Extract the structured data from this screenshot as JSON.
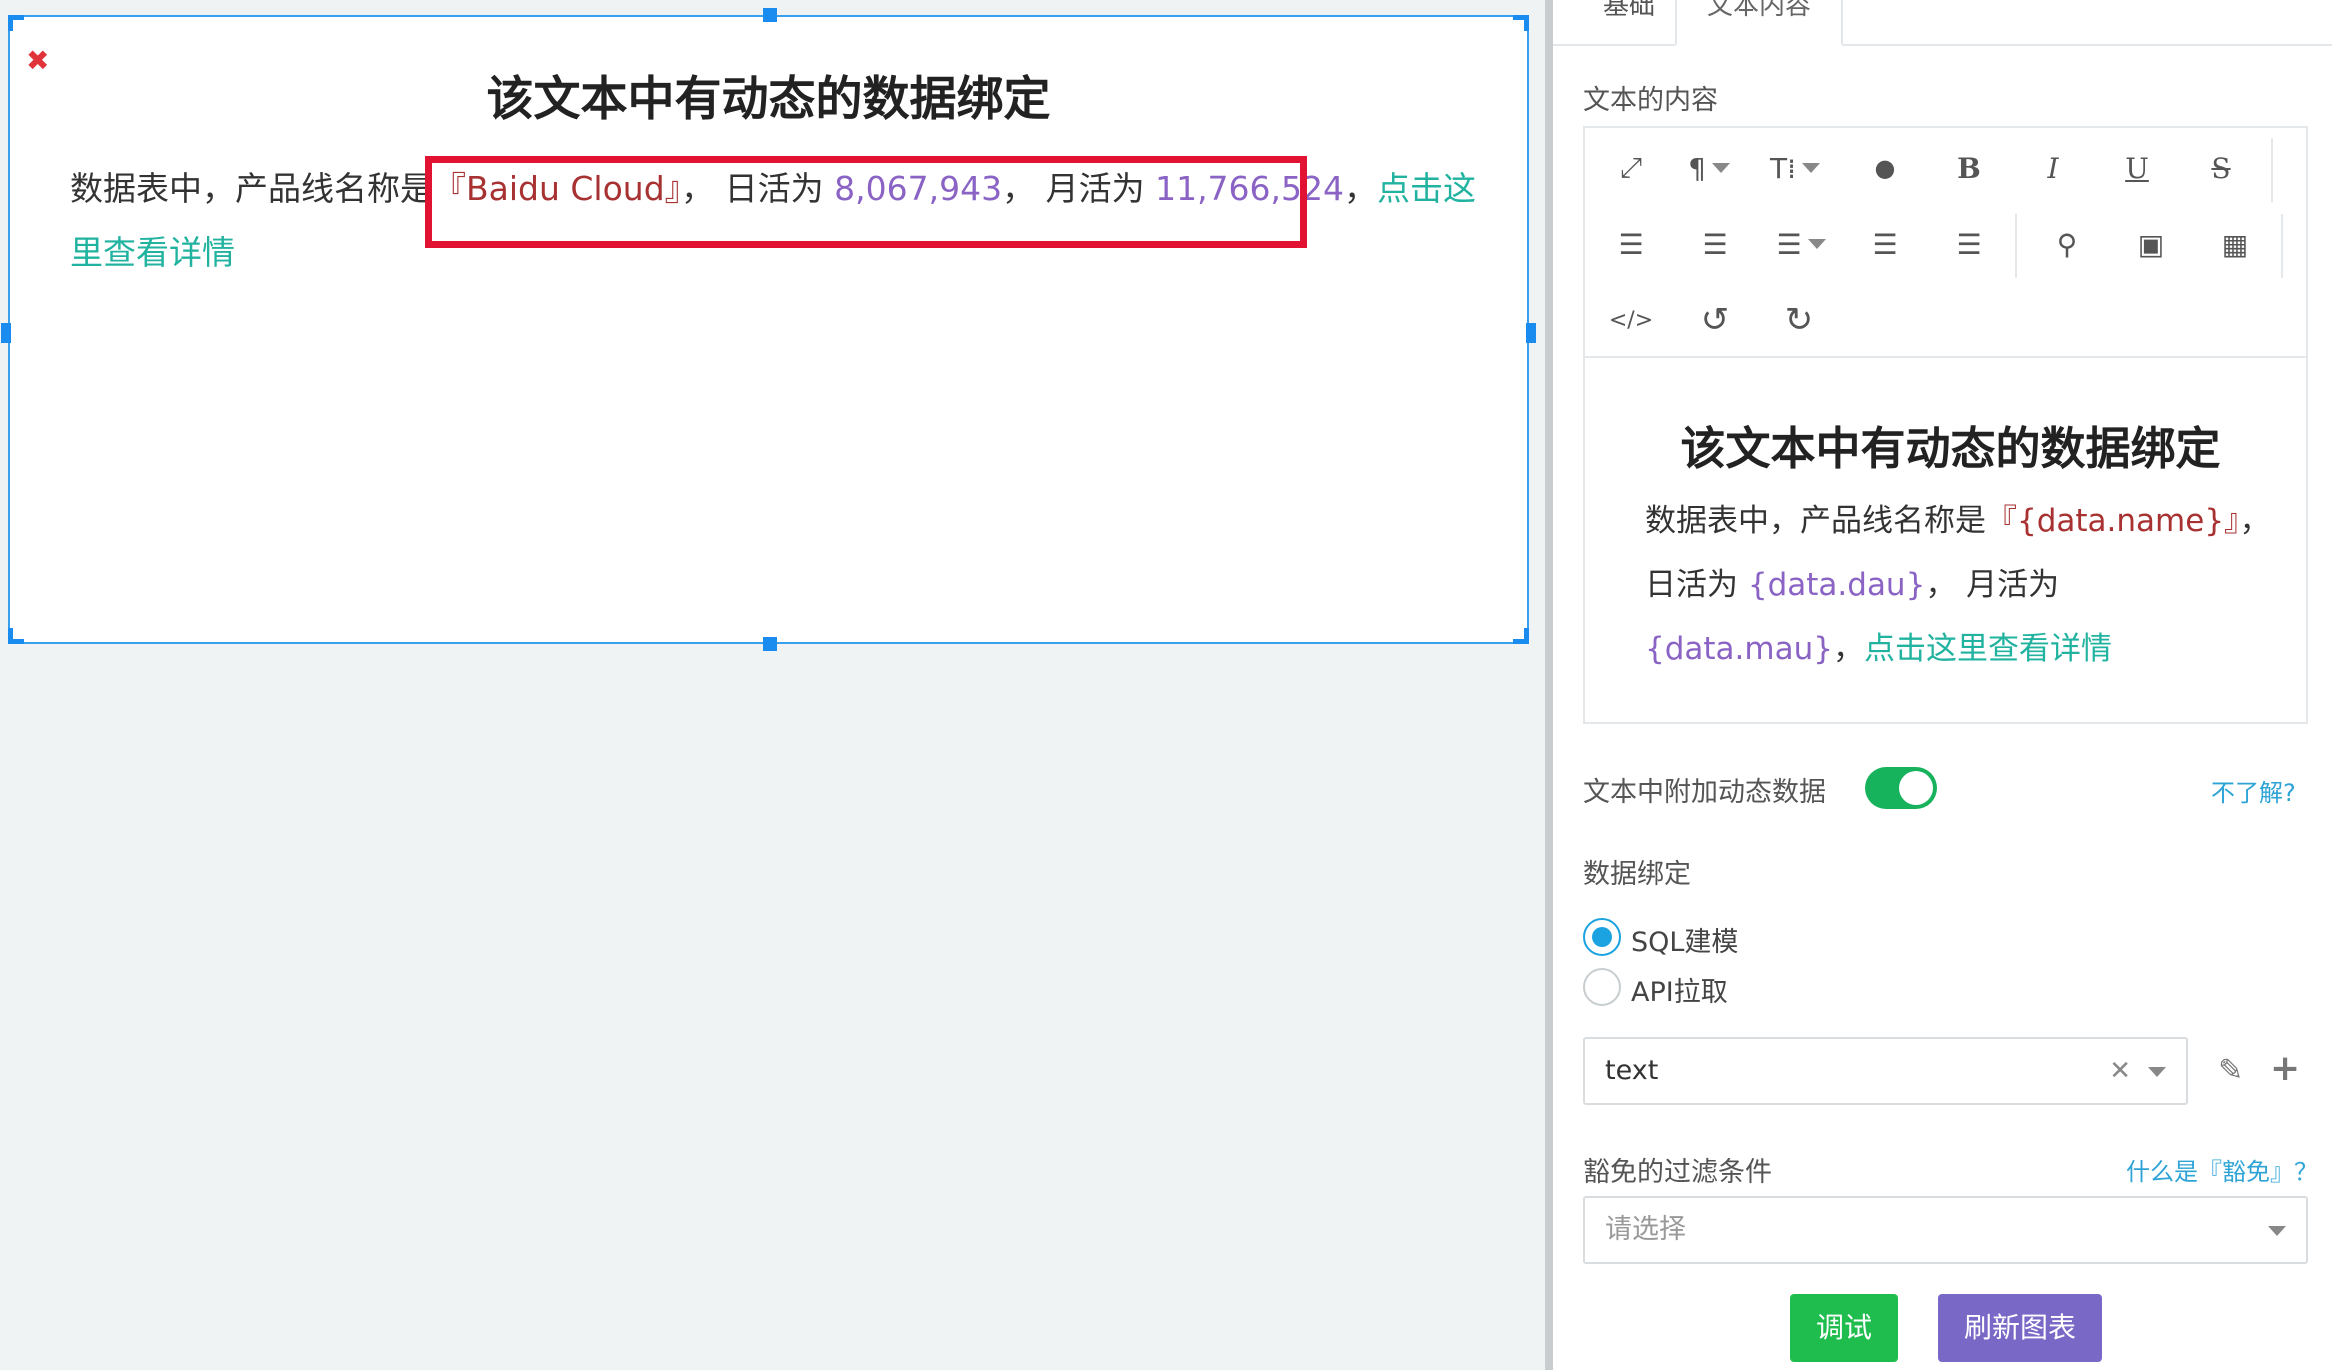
{
  "canvas": {
    "widget": {
      "title": "该文本中有动态的数据绑定",
      "prefix": "数据表中，产品线名称是",
      "product_name": "『Baidu Cloud』",
      "sep1": "，",
      "dau_label": " 日活为 ",
      "dau_value": "8,067,943",
      "sep2": "，",
      "mau_label": " 月活为 ",
      "mau_value": "11,766,524",
      "sep3": "，",
      "link_text": "点击这里查看详情"
    },
    "close_glyph": "✖"
  },
  "panel": {
    "tabs": [
      "基础",
      "文本内容"
    ],
    "content_label": "文本的内容",
    "editor": {
      "title": "该文本中有动态的数据绑定",
      "prefix": "数据表中，产品线名称是",
      "name_var": "『{data.name}』",
      "sep1": "，",
      "dau_label": "日活为 ",
      "dau_var": "{data.dau}",
      "sep2": "，",
      "mau_label": " 月活为 ",
      "mau_var": "{data.mau}",
      "sep3": "，",
      "link_text": "点击这里查看详情"
    },
    "toolbar": {
      "fullscreen": "⤢",
      "paragraph": "¶",
      "font_size": "T⁞",
      "color": "●",
      "bold": "B",
      "italic": "I",
      "underline": "U",
      "strike": "S",
      "ordered_list": "☰",
      "unordered_list": "☰",
      "align": "☰",
      "outdent": "☰",
      "indent": "☰",
      "link": "⚲",
      "image": "▣",
      "table": "▦",
      "code": "</>",
      "undo": "↺",
      "redo": "↻"
    },
    "dynamic_label": "文本中附加动态数据",
    "dynamic_enabled": true,
    "help_dynamic": "不了解?",
    "binding_label": "数据绑定",
    "radio_sql": "SQL建模",
    "radio_api": "API拉取",
    "selected_source": "text",
    "filter_label": "豁免的过滤条件",
    "help_filter": "什么是『豁免』？",
    "filter_placeholder": "请选择",
    "debug_button": "调试",
    "refresh_button": "刷新图表"
  }
}
